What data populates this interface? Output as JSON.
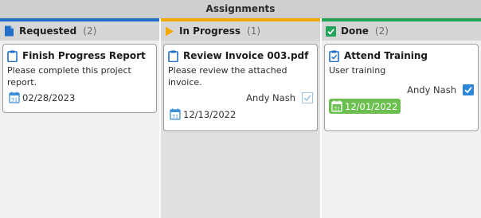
{
  "board": {
    "title": "Assignments",
    "colors": {
      "requested": "#1f6fc8",
      "in_progress": "#f2a900",
      "done": "#21a35a",
      "done_date_bg": "#6bbf4e"
    }
  },
  "columns": [
    {
      "title": "Requested",
      "count": "(2)",
      "icon": "document-icon",
      "cards": [
        {
          "title": "Finish Progress Report",
          "description": "Please complete this project report.",
          "assignee": "",
          "date": "02/28/2023",
          "checkbox": false
        }
      ]
    },
    {
      "title": "In Progress",
      "count": "(1)",
      "icon": "play-triangle-icon",
      "cards": [
        {
          "title": "Review Invoice 003.pdf",
          "description": "Please review the attached invoice.",
          "assignee": "Andy Nash",
          "date": "12/13/2022",
          "checkbox": true,
          "checked_light": true
        }
      ]
    },
    {
      "title": "Done",
      "count": "(2)",
      "icon": "checkbox-checked-icon",
      "cards": [
        {
          "title": "Attend Training",
          "description": "User training",
          "assignee": "Andy Nash",
          "date": "12/01/2022",
          "checkbox": true,
          "checked_light": false
        }
      ]
    }
  ]
}
